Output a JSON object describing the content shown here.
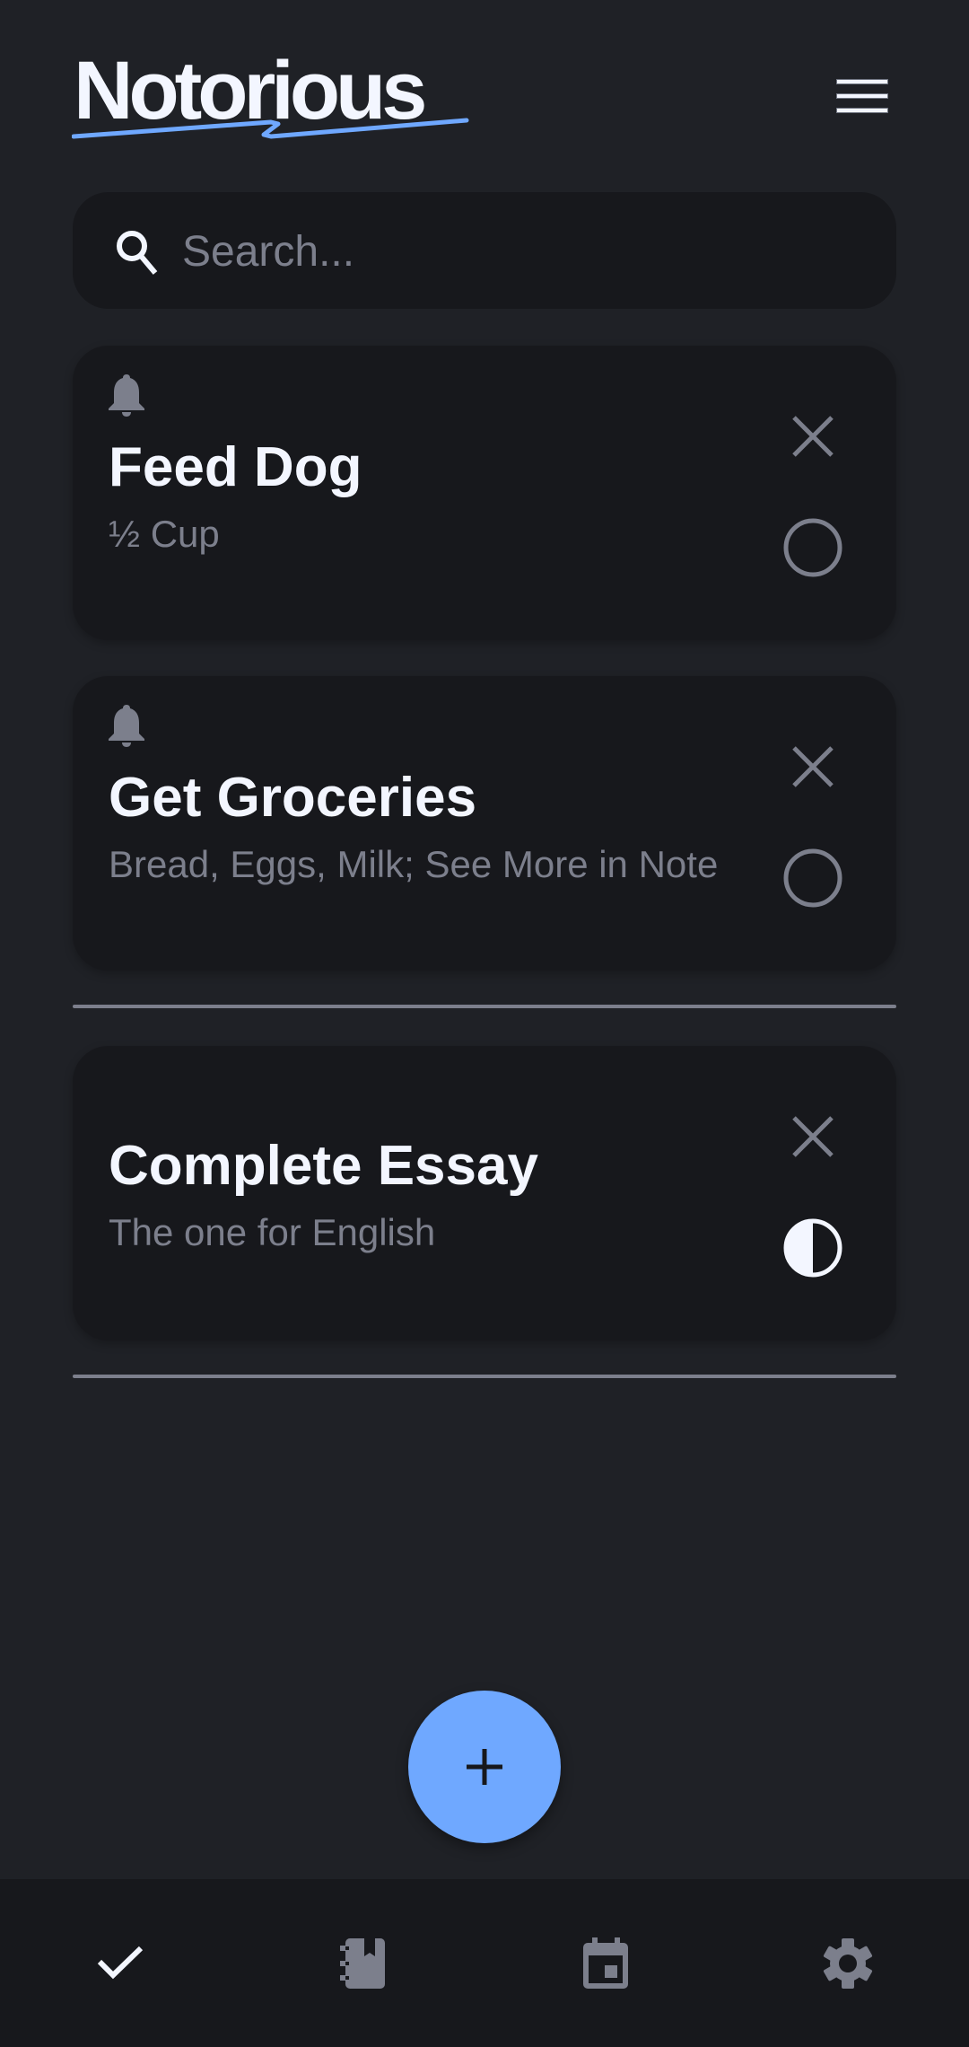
{
  "app": {
    "title": "Notorious",
    "accent_color": "#6fa8ff",
    "background_color": "#1f2126",
    "card_color": "#17181c",
    "muted_color": "#7c7f8c",
    "text_color": "#f3f6ff"
  },
  "header": {
    "logo": "Notorious",
    "menu_icon": "hamburger-menu-icon"
  },
  "search": {
    "placeholder": "Search...",
    "value": "",
    "icon": "search-icon"
  },
  "tasks": [
    {
      "title": "Feed Dog",
      "description": "½ Cup",
      "has_reminder": true,
      "status": "not-started",
      "status_icon": "empty-circle-icon",
      "close_icon": "close-icon"
    },
    {
      "title": "Get Groceries",
      "description": "Bread, Eggs, Milk; See More in Note",
      "has_reminder": true,
      "status": "not-started",
      "status_icon": "empty-circle-icon",
      "close_icon": "close-icon"
    },
    {
      "title": "Complete Essay",
      "description": "The one for English",
      "has_reminder": false,
      "status": "in-progress",
      "status_icon": "half-circle-icon",
      "close_icon": "close-icon"
    }
  ],
  "fab": {
    "icon": "plus-icon",
    "label": "Add task"
  },
  "bottom_nav": {
    "items": [
      {
        "name": "tasks",
        "icon": "check-icon",
        "active": true
      },
      {
        "name": "notes",
        "icon": "notebook-icon",
        "active": false
      },
      {
        "name": "calendar",
        "icon": "calendar-icon",
        "active": false
      },
      {
        "name": "settings",
        "icon": "gear-icon",
        "active": false
      }
    ]
  }
}
